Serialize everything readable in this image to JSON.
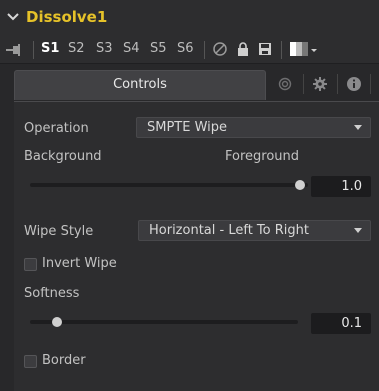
{
  "header": {
    "title": "Dissolve1"
  },
  "toolbar": {
    "slots": [
      "S1",
      "S2",
      "S3",
      "S4",
      "S5",
      "S6"
    ],
    "active_slot": "S1"
  },
  "tabs": {
    "controls_label": "Controls"
  },
  "controls": {
    "operation": {
      "label": "Operation",
      "value": "SMPTE Wipe"
    },
    "background_label": "Background",
    "foreground_label": "Foreground",
    "mix": {
      "value": "1.0",
      "level": 1.0
    },
    "wipe_style": {
      "label": "Wipe Style",
      "value": "Horizontal - Left To Right"
    },
    "invert_wipe": {
      "label": "Invert Wipe",
      "checked": false
    },
    "softness": {
      "label": "Softness",
      "value": "0.1",
      "level": 0.1
    },
    "border": {
      "label": "Border",
      "checked": false
    }
  },
  "colors": {
    "accent_title": "#e6c229",
    "panel": "#2d2d2f"
  }
}
